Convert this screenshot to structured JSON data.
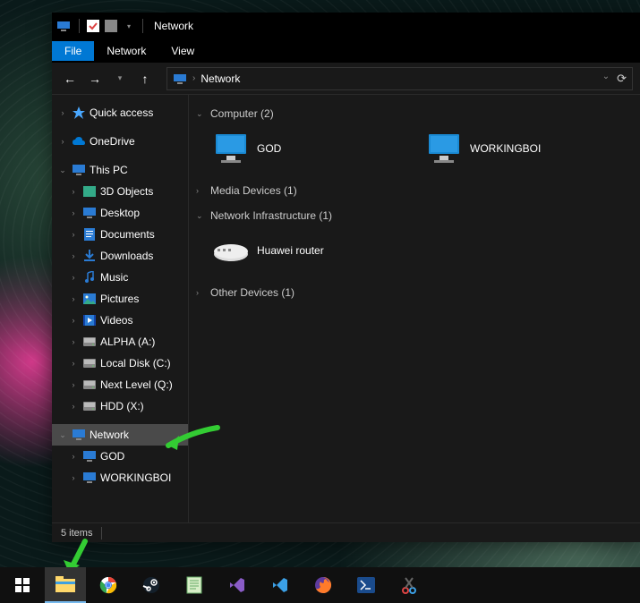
{
  "window": {
    "title": "Network",
    "menu": {
      "file": "File",
      "network": "Network",
      "view": "View"
    },
    "breadcrumb": "Network",
    "statusbar": "5 items"
  },
  "sidebar": {
    "quick_access": "Quick access",
    "onedrive": "OneDrive",
    "this_pc": "This PC",
    "items": [
      "3D Objects",
      "Desktop",
      "Documents",
      "Downloads",
      "Music",
      "Pictures",
      "Videos",
      "ALPHA (A:)",
      "Local Disk (C:)",
      "Next Level (Q:)",
      "HDD (X:)"
    ],
    "network": "Network",
    "network_items": [
      "GOD",
      "WORKINGBOI"
    ]
  },
  "content": {
    "groups": [
      {
        "label": "Computer (2)",
        "expanded": true,
        "items": [
          "GOD",
          "WORKINGBOI"
        ]
      },
      {
        "label": "Media Devices (1)",
        "expanded": false,
        "items": []
      },
      {
        "label": "Network Infrastructure (1)",
        "expanded": true,
        "items": [
          "Huawei router"
        ]
      },
      {
        "label": "Other Devices (1)",
        "expanded": false,
        "items": []
      }
    ]
  }
}
